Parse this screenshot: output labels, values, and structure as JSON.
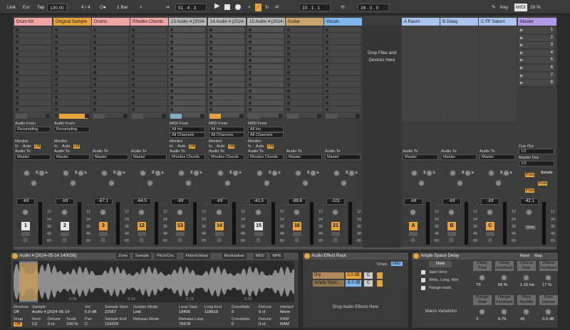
{
  "transport": {
    "link": "Link",
    "ext": "Ext",
    "tap": "Tap",
    "tempo": "130.00",
    "signature": "4 / 4",
    "metro": "O●",
    "quant": "1 Bar",
    "position": "51 .   4 .   3",
    "loop_start": "33 .   1 .   1",
    "loop_len": "16 .   0 .   0",
    "key": "Key",
    "midi": "MIDI",
    "cpu": "28 %"
  },
  "tracks": [
    {
      "name": "Drum Kit",
      "color": "#f2a4a4",
      "in_label": "Audio From",
      "in_value": "Resampling",
      "monitor": "Monitor",
      "mon_in": "In",
      "mon_auto": "Auto",
      "mon_off": "Off",
      "out_label": "Audio To",
      "out_value": "Master",
      "sends": "Sends",
      "volume": "-Inf",
      "number": "1",
      "num_color": "#e6e6e6"
    },
    {
      "name": "Original Sample",
      "color": "#e8a33c",
      "in_label": "Audio From",
      "in_value": "Resampling",
      "monitor": "Monitor",
      "mon_in": "In",
      "mon_auto": "Auto",
      "mon_off": "Off",
      "out_label": "Audio To",
      "out_value": "Master",
      "sends": "Sends",
      "volume": "-Inf",
      "number": "2",
      "num_color": "#e6e6e6"
    },
    {
      "name": "Drums",
      "color": "#f2a4a4",
      "out_label": "Audio To",
      "out_value": "Master",
      "sends": "Sends",
      "volume": "-67.1",
      "number": "3",
      "num_color": "#e8a33c"
    },
    {
      "name": "Rhodes Chords",
      "color": "#f2a4a4",
      "out_label": "Audio To",
      "out_value": "Master",
      "sends": "Sends",
      "volume": "-64.5",
      "number": "12",
      "num_color": "#e8a33c"
    },
    {
      "name": "13 Audio 4 [2024-",
      "color": "#b8b8b8",
      "in_label": "MIDI From",
      "in_value": "All Ins",
      "in_ch": "All Channels",
      "monitor": "Monitor",
      "mon_in": "In",
      "mon_auto": "Auto",
      "mon_off": "Off",
      "out_label": "Audio To",
      "out_value": "Rhodes Chords",
      "sends": "Sends",
      "volume": "-Inf",
      "number": "13",
      "num_color": "#e8a33c"
    },
    {
      "name": "14 Audio 4 [2024-",
      "color": "#b8b8b8",
      "in_label": "MIDI From",
      "in_value": "All Ins",
      "in_ch": "All Channels",
      "monitor": "Monitor",
      "mon_in": "In",
      "mon_auto": "Auto",
      "mon_off": "Off",
      "out_label": "Audio To",
      "out_value": "Rhodes Chords",
      "sends": "Sends",
      "volume": "-Inf",
      "number": "14",
      "num_color": "#e8a33c"
    },
    {
      "name": "15 Audio 4 [2024-",
      "color": "#b8b8b8",
      "in_label": "MIDI From",
      "in_value": "All Ins",
      "in_ch": "All Channels",
      "monitor": "Monitor",
      "mon_in": "In",
      "mon_auto": "Auto",
      "mon_off": "Off",
      "out_label": "Audio To",
      "out_value": "Rhodes Chords",
      "sends": "Sends",
      "volume": "-41.5",
      "number": "15",
      "num_color": "#e6e6e6"
    },
    {
      "name": "Guitar",
      "color": "#c9a46b",
      "out_label": "Audio To",
      "out_value": "Master",
      "sends": "Sends",
      "volume": "-89.6",
      "number": "16",
      "num_color": "#e8a33c"
    },
    {
      "name": "Vocals",
      "color": "#7fb7f0",
      "out_label": "Audio To",
      "out_value": "Master",
      "sends": "Sends",
      "volume": "-101",
      "number": "21",
      "num_color": "#e8a33c"
    }
  ],
  "drop_zone": "Drop Files and Devices Here",
  "returns": [
    {
      "name": "A Raum",
      "out_label": "Audio To",
      "out_value": "Master",
      "sends": "Sends",
      "volume": "-Inf",
      "letter": "A"
    },
    {
      "name": "B Delay",
      "out_label": "Audio To",
      "out_value": "Master",
      "sends": "Sends",
      "volume": "-Inf",
      "letter": "B"
    },
    {
      "name": "C FF Saturn",
      "out_label": "Audio To",
      "out_value": "Master",
      "sends": "Sends",
      "volume": "-Inf",
      "letter": "C"
    }
  ],
  "master": {
    "name": "Master",
    "scenes": [
      "1",
      "2",
      "3",
      "4",
      "5",
      "6",
      "7",
      "8"
    ],
    "cue_label": "Cue Out",
    "cue_value": "1/2",
    "out_label": "Master Out",
    "out_value": "1/2",
    "sends": "Sends",
    "post": "Post",
    "volume": "-42.1",
    "solo": "Solo"
  },
  "db_scale": [
    "-",
    "12",
    "24",
    "36",
    "48",
    "60"
  ],
  "clip": {
    "title": "Audio 4 [2024-05-14 140038]",
    "tabs": [
      "Zone",
      "Sample",
      "Pitch/Osc",
      "Filter/Global",
      "Modulation",
      "MIDI",
      "MPE"
    ],
    "ruler": [
      "0:05",
      "0:10",
      "0:15",
      "0:20"
    ],
    "fields": [
      {
        "l": "Reverse",
        "v": "Off"
      },
      {
        "l": "Sample",
        "v": "Audio 4 [2024-05-14"
      },
      {
        "l": "Vol",
        "v": "0.0 dB"
      },
      {
        "l": "Sample Start",
        "v": "22557"
      },
      {
        "l": "Sustain Mode",
        "v": "Link"
      },
      {
        "l": "Loop Start",
        "v": "18405"
      },
      {
        "l": "Loop End",
        "v": "118818"
      },
      {
        "l": "Crossfade",
        "v": "0"
      },
      {
        "l": "Detune",
        "v": "0 ct"
      },
      {
        "l": "Interpol",
        "v": "Norm"
      }
    ],
    "fields2": [
      {
        "l": "Snap",
        "v": "Off"
      },
      {
        "l": "Root",
        "v": "C3"
      },
      {
        "l": "Detune",
        "v": "0 ct"
      },
      {
        "l": "Scale",
        "v": "100 %"
      },
      {
        "l": "Pan",
        "v": "C"
      },
      {
        "l": "Sample End",
        "v": "119229"
      },
      {
        "l": "Release Mode",
        "v": ""
      },
      {
        "l": "Release Loop",
        "v": "75678"
      },
      {
        "l": "Crossfade",
        "v": "0"
      },
      {
        "l": "Detune",
        "v": "0 ct"
      },
      {
        "l": "RAM",
        "v": "RAM"
      }
    ]
  },
  "rack": {
    "title": "Audio Effect Rack",
    "chain": "Chain",
    "hide": "Hide",
    "chains": [
      {
        "name": "Dry",
        "gain": "0.0 dB",
        "pan": "C"
      },
      {
        "name": "Ample Spac...",
        "gain": "-6.0 dB",
        "pan": "C"
      }
    ],
    "drop": "Drop Audio Effects Here"
  },
  "delay": {
    "title": "Ample Space Delay",
    "rand": "Rand",
    "map": "Map",
    "new": "New",
    "presets": [
      "Start Here",
      "Wide, Long, Wet",
      "Flange-tastic"
    ],
    "variations": "Macro Variations",
    "macros": [
      {
        "name": "Delay Time",
        "value": "73"
      },
      {
        "name": "Delay Feedback",
        "value": "56 %"
      },
      {
        "name": "Chorus Rate",
        "value": "1.15 Hz"
      },
      {
        "name": "Chorus Feedback",
        "value": "17 %"
      },
      {
        "name": "Flanger Rate",
        "value": "3"
      },
      {
        "name": "Flanger Feedback",
        "value": "0.79"
      },
      {
        "name": "Rack Dry/Wet",
        "value": "45"
      },
      {
        "name": "Rack Volume",
        "value": "0.0 dB"
      }
    ]
  }
}
